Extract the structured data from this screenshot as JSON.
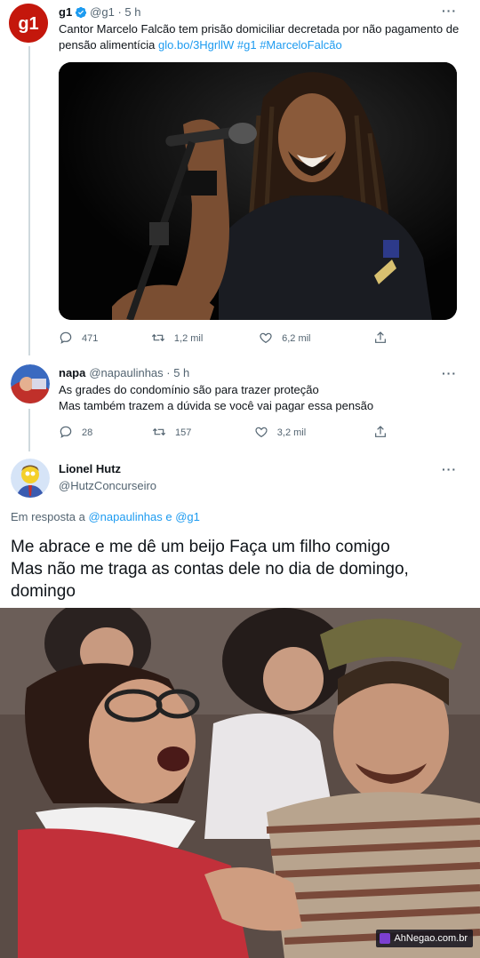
{
  "tweet1": {
    "name": "g1",
    "handle": "@g1 · 5 h",
    "text": "Cantor Marcelo Falcão tem prisão domiciliar decretada por não pagamento de pensão alimentícia",
    "links": "glo.bo/3HgrllW #g1 #MarceloFalcão",
    "replies": "471",
    "retweets": "1,2 mil",
    "likes": "6,2 mil",
    "avatar_text": "g1",
    "verified_color": "#1d9bf0",
    "brand_color": "#c4170c"
  },
  "tweet2": {
    "name": "napa",
    "handle": "@napaulinhas · 5 h",
    "line1": "As grades do condomínio são para trazer proteção",
    "line2": "Mas também trazem a dúvida se você vai pagar essa pensão",
    "replies": "28",
    "retweets": "157",
    "likes": "3,2 mil"
  },
  "tweet3": {
    "name": "Lionel Hutz",
    "handle": "@HutzConcurseiro",
    "reply_prefix": "Em resposta a",
    "reply_users": "@napaulinhas e @g1",
    "line1": "Me abrace e me dê um beijo Faça um filho comigo",
    "line2": "Mas não me traga as contas dele no dia de domingo,",
    "line3": "domingo"
  },
  "watermark": "AhNegao.com.br"
}
